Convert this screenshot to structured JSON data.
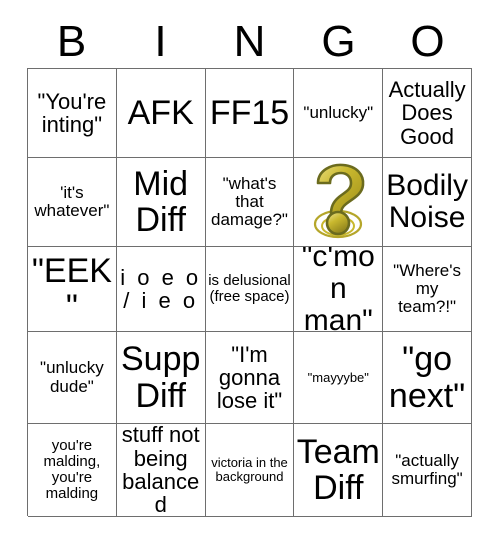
{
  "card": {
    "title": "BINGO",
    "header_letters": [
      "B",
      "I",
      "N",
      "G",
      "O"
    ],
    "grid_line_color": "#6e6e6e",
    "background_color": "#ffffff",
    "text_color": "#000000",
    "free_space_icon": {
      "name": "question-mark-icon",
      "outline_color": "#6b6b1e",
      "fill_color": "#c9b82e",
      "highlight_color": "#e8dc7a",
      "ring_color": "#b5a62a"
    },
    "rows": [
      [
        {
          "text": "\"You're inting\"",
          "size": "fs-md"
        },
        {
          "text": "AFK",
          "size": "fs-xl"
        },
        {
          "text": "FF15",
          "size": "fs-xl"
        },
        {
          "text": "\"unlucky\"",
          "size": "fs-sm"
        },
        {
          "text": "Actually Does Good",
          "size": "fs-md"
        }
      ],
      [
        {
          "text": "'it's whatever\"",
          "size": "fs-sm"
        },
        {
          "text": "Mid Diff",
          "size": "fs-xl"
        },
        {
          "text": "\"what's that damage?\"",
          "size": "fs-sm"
        },
        {
          "text": "",
          "size": "fs-md",
          "icon": "question-mark-icon"
        },
        {
          "text": "Bodily Noise",
          "size": "fs-lg"
        }
      ],
      [
        {
          "text": "\"EEK\"",
          "size": "fs-xl"
        },
        {
          "text": "i o e o / i e o",
          "size": "fs-md"
        },
        {
          "text": "is delusional (free space)",
          "size": "fs-xs"
        },
        {
          "text": "\"c'mon man\"",
          "size": "fs-lg"
        },
        {
          "text": "\"Where's my team?!\"",
          "size": "fs-sm"
        }
      ],
      [
        {
          "text": "\"unlucky dude\"",
          "size": "fs-sm"
        },
        {
          "text": "Supp Diff",
          "size": "fs-xl"
        },
        {
          "text": "\"I'm gonna lose it\"",
          "size": "fs-md"
        },
        {
          "text": "\"mayyybe\"",
          "size": "fs-xxs"
        },
        {
          "text": "\"go next\"",
          "size": "fs-xl"
        }
      ],
      [
        {
          "text": "you're malding, you're malding",
          "size": "fs-xs"
        },
        {
          "text": "stuff not being balanced",
          "size": "fs-md"
        },
        {
          "text": "victoria in the background",
          "size": "fs-xxs"
        },
        {
          "text": "Team Diff",
          "size": "fs-xl"
        },
        {
          "text": "\"actually smurfing\"",
          "size": "fs-sm"
        }
      ]
    ]
  }
}
